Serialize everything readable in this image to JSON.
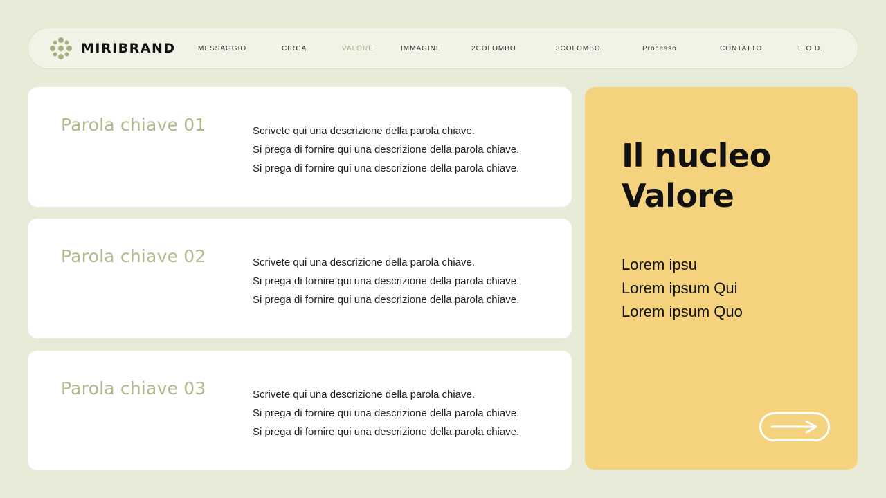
{
  "brand": {
    "name": "MIRIBRAND",
    "logo_icon": "flower-dots-icon",
    "accent": "#a7ad82"
  },
  "nav": {
    "items": [
      {
        "label": "MESSAGGIO",
        "active": false
      },
      {
        "label": "CIRCA",
        "active": false
      },
      {
        "label": "VALORE",
        "active": true
      },
      {
        "label": "IMMAGINE",
        "active": false
      },
      {
        "label": "2COLOMBO",
        "active": false
      },
      {
        "label": "3COLOMBO",
        "active": false
      },
      {
        "label": "Processo",
        "active": false
      },
      {
        "label": "CONTATTO",
        "active": false
      },
      {
        "label": "E.O.D.",
        "active": false
      }
    ]
  },
  "cards": [
    {
      "title": "Parola chiave 01",
      "lines": [
        "Scrivete qui una descrizione della parola chiave.",
        "Si prega di fornire qui una descrizione della parola chiave.",
        "Si prega di fornire qui una descrizione della parola chiave."
      ]
    },
    {
      "title": "Parola chiave 02",
      "lines": [
        "Scrivete qui una descrizione della parola chiave.",
        "Si prega di fornire qui una descrizione della parola chiave.",
        "Si prega di fornire qui una descrizione della parola chiave."
      ]
    },
    {
      "title": "Parola chiave 03",
      "lines": [
        "Scrivete qui una descrizione della parola chiave.",
        "Si prega di fornire qui una descrizione della parola chiave.",
        "Si prega di fornire qui una descrizione della parola chiave."
      ]
    }
  ],
  "panel": {
    "title_line1": "Il nucleo",
    "title_line2": "Valore",
    "list": [
      "Lorem ipsu",
      "Lorem ipsum Qui",
      "Lorem ipsum Quo"
    ],
    "arrow_icon": "arrow-right-icon",
    "background": "#f4d27e"
  }
}
